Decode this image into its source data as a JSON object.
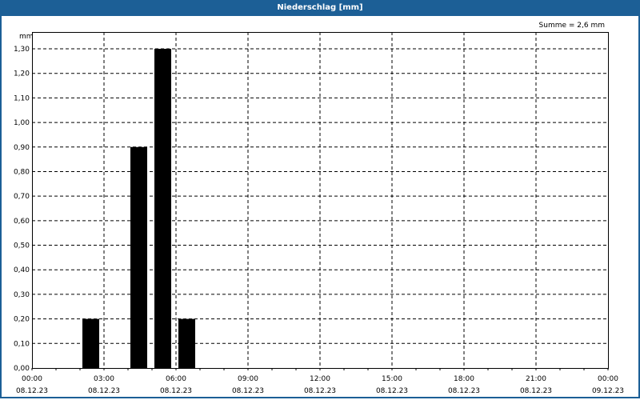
{
  "chart_data": {
    "type": "bar",
    "title": "Niederschlag [mm]",
    "ylabel": "mm",
    "annotation": "Summe = 2,6 mm",
    "ylim": [
      0,
      1.3
    ],
    "yticks": [
      "0,00",
      "0,10",
      "0,20",
      "0,30",
      "0,40",
      "0,50",
      "0,60",
      "0,70",
      "0,80",
      "0,90",
      "1,00",
      "1,10",
      "1,20",
      "1,30"
    ],
    "xlim_hours": [
      0,
      24
    ],
    "xticks": [
      {
        "time": "00:00",
        "date": "08.12.23"
      },
      {
        "time": "03:00",
        "date": "08.12.23"
      },
      {
        "time": "06:00",
        "date": "08.12.23"
      },
      {
        "time": "09:00",
        "date": "08.12.23"
      },
      {
        "time": "12:00",
        "date": "08.12.23"
      },
      {
        "time": "15:00",
        "date": "08.12.23"
      },
      {
        "time": "18:00",
        "date": "08.12.23"
      },
      {
        "time": "21:00",
        "date": "08.12.23"
      },
      {
        "time": "00:00",
        "date": "09.12.23"
      }
    ],
    "bars": [
      {
        "hour_start": 2,
        "value": 0.2
      },
      {
        "hour_start": 4,
        "value": 0.9
      },
      {
        "hour_start": 5,
        "value": 1.3
      },
      {
        "hour_start": 6,
        "value": 0.2
      }
    ],
    "grid": true,
    "colors": {
      "bar": "#000000",
      "title_bar": "#1c5f96"
    }
  }
}
